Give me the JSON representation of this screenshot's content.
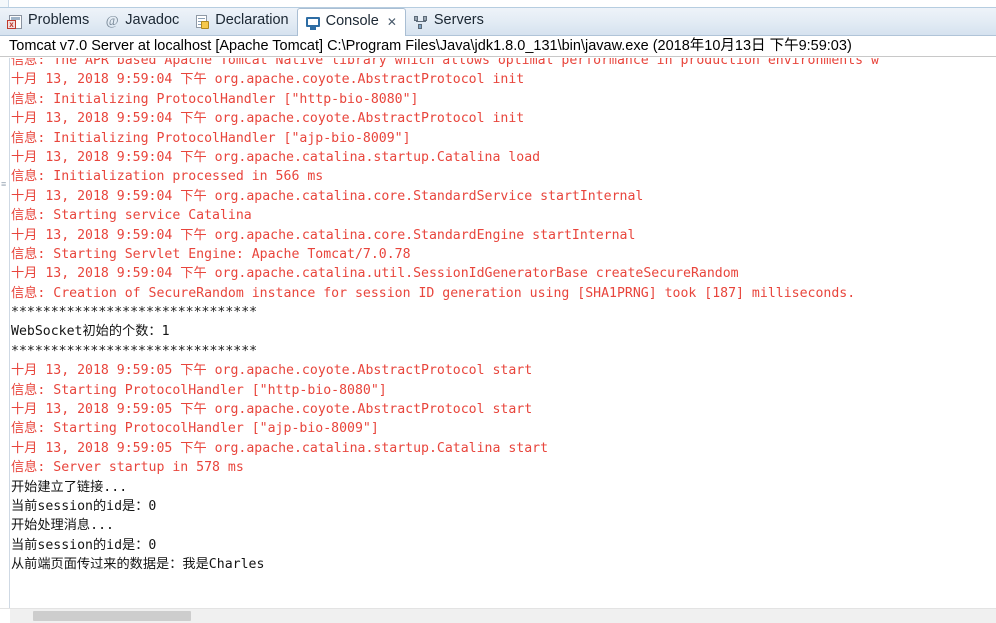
{
  "window": {
    "tabs": [
      {
        "label": "Problems",
        "icon": "problems-icon",
        "active": false,
        "closable": false
      },
      {
        "label": "Javadoc",
        "icon": "javadoc-icon",
        "active": false,
        "closable": false
      },
      {
        "label": "Declaration",
        "icon": "declaration-icon",
        "active": false,
        "closable": false
      },
      {
        "label": "Console",
        "icon": "console-icon",
        "active": true,
        "closable": true
      },
      {
        "label": "Servers",
        "icon": "servers-icon",
        "active": false,
        "closable": false
      }
    ],
    "close_glyph": "✕"
  },
  "console": {
    "title": "Tomcat v7.0 Server at localhost [Apache Tomcat] C:\\Program Files\\Java\\jdk1.8.0_131\\bin\\javaw.exe (2018年10月13日 下午9:59:03)",
    "colors": {
      "error_stream": "#e8453c",
      "standard_stream": "#141414",
      "background": "#ffffff",
      "tab_active_background": "#ffffff"
    },
    "lines": [
      {
        "stream": "err",
        "text": "信息: The APR based Apache Tomcat Native library which allows optimal performance in production environments w"
      },
      {
        "stream": "err",
        "text": "十月 13, 2018 9:59:04 下午 org.apache.coyote.AbstractProtocol init"
      },
      {
        "stream": "err",
        "text": "信息: Initializing ProtocolHandler [\"http-bio-8080\"]"
      },
      {
        "stream": "err",
        "text": "十月 13, 2018 9:59:04 下午 org.apache.coyote.AbstractProtocol init"
      },
      {
        "stream": "err",
        "text": "信息: Initializing ProtocolHandler [\"ajp-bio-8009\"]"
      },
      {
        "stream": "err",
        "text": "十月 13, 2018 9:59:04 下午 org.apache.catalina.startup.Catalina load"
      },
      {
        "stream": "err",
        "text": "信息: Initialization processed in 566 ms"
      },
      {
        "stream": "err",
        "text": "十月 13, 2018 9:59:04 下午 org.apache.catalina.core.StandardService startInternal"
      },
      {
        "stream": "err",
        "text": "信息: Starting service Catalina"
      },
      {
        "stream": "err",
        "text": "十月 13, 2018 9:59:04 下午 org.apache.catalina.core.StandardEngine startInternal"
      },
      {
        "stream": "err",
        "text": "信息: Starting Servlet Engine: Apache Tomcat/7.0.78"
      },
      {
        "stream": "err",
        "text": "十月 13, 2018 9:59:04 下午 org.apache.catalina.util.SessionIdGeneratorBase createSecureRandom"
      },
      {
        "stream": "err",
        "text": "信息: Creation of SecureRandom instance for session ID generation using [SHA1PRNG] took [187] milliseconds."
      },
      {
        "stream": "out",
        "text": "*******************************"
      },
      {
        "stream": "out",
        "text": "WebSocket初始的个数：1"
      },
      {
        "stream": "out",
        "text": "*******************************"
      },
      {
        "stream": "err",
        "text": "十月 13, 2018 9:59:05 下午 org.apache.coyote.AbstractProtocol start"
      },
      {
        "stream": "err",
        "text": "信息: Starting ProtocolHandler [\"http-bio-8080\"]"
      },
      {
        "stream": "err",
        "text": "十月 13, 2018 9:59:05 下午 org.apache.coyote.AbstractProtocol start"
      },
      {
        "stream": "err",
        "text": "信息: Starting ProtocolHandler [\"ajp-bio-8009\"]"
      },
      {
        "stream": "err",
        "text": "十月 13, 2018 9:59:05 下午 org.apache.catalina.startup.Catalina start"
      },
      {
        "stream": "err",
        "text": "信息: Server startup in 578 ms"
      },
      {
        "stream": "out",
        "text": "开始建立了链接..."
      },
      {
        "stream": "out",
        "text": "当前session的id是：0"
      },
      {
        "stream": "out",
        "text": "开始处理消息..."
      },
      {
        "stream": "out",
        "text": "当前session的id是：0"
      },
      {
        "stream": "out",
        "text": "从前端页面传过来的数据是：我是Charles"
      }
    ],
    "gutter_marker": "≡"
  }
}
